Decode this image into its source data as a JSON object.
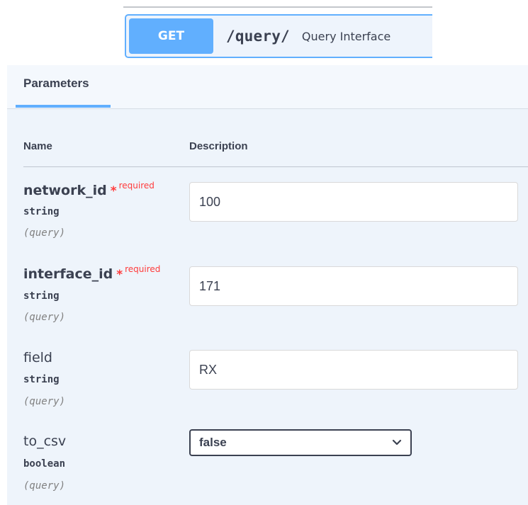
{
  "endpoint": {
    "method": "GET",
    "path": "/query/",
    "summary": "Query Interface"
  },
  "tabs": [
    {
      "label": "Parameters",
      "active": true
    }
  ],
  "table_headers": {
    "name": "Name",
    "description": "Description"
  },
  "parameters": [
    {
      "name": "network_id",
      "required": true,
      "required_marker": "*",
      "required_label": "required",
      "type": "string",
      "in": "(query)",
      "value": "100"
    },
    {
      "name": "interface_id",
      "required": true,
      "required_marker": "*",
      "required_label": "required",
      "type": "string",
      "in": "(query)",
      "value": "171"
    },
    {
      "name": "field",
      "required": false,
      "type": "string",
      "in": "(query)",
      "value": "RX"
    },
    {
      "name": "to_csv",
      "required": false,
      "type": "boolean",
      "in": "(query)",
      "value": "false",
      "control": "select",
      "icon": "chevron-down-icon"
    }
  ],
  "colors": {
    "get_method": "#61affe",
    "required": "#ff3b3b",
    "text": "#3b4151"
  }
}
